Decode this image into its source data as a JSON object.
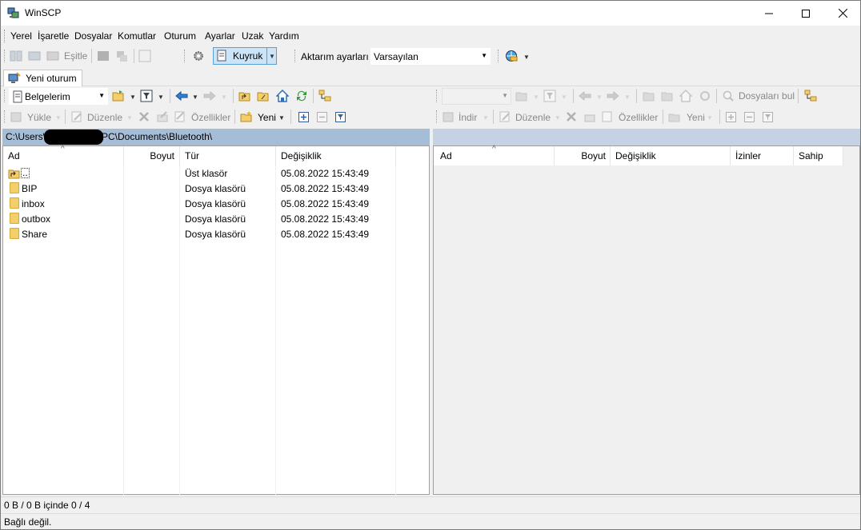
{
  "window": {
    "title": "WinSCP"
  },
  "menu": [
    "Yerel",
    "İşaretle",
    "Dosyalar",
    "Komutlar",
    "Oturum",
    "Ayarlar",
    "Uzak",
    "Yardım"
  ],
  "toolbar": {
    "synchronize_label": "Eşitle",
    "queue_label": "Kuyruk",
    "transfer_settings_label": "Aktarım ayarları",
    "transfer_settings_value": "Varsayılan"
  },
  "session_tab": {
    "label": "Yeni oturum"
  },
  "left_panel": {
    "location": "Belgelerim",
    "path_prefix": "C:\\Users\\",
    "path_suffix": "PC\\Documents\\Bluetooth\\",
    "actions": {
      "upload": "Yükle",
      "edit": "Düzenle",
      "properties": "Özellikler",
      "new": "Yeni"
    },
    "columns": {
      "name": "Ad",
      "size": "Boyut",
      "type": "Tür",
      "changed": "Değişiklik"
    },
    "rows": [
      {
        "name": "..",
        "type": "Üst klasör",
        "changed": "05.08.2022  15:43:49",
        "icon": "parent-folder-icon"
      },
      {
        "name": "BIP",
        "type": "Dosya klasörü",
        "changed": "05.08.2022  15:43:49",
        "icon": "folder-icon"
      },
      {
        "name": "inbox",
        "type": "Dosya klasörü",
        "changed": "05.08.2022  15:43:49",
        "icon": "folder-icon"
      },
      {
        "name": "outbox",
        "type": "Dosya klasörü",
        "changed": "05.08.2022  15:43:49",
        "icon": "folder-icon"
      },
      {
        "name": "Share",
        "type": "Dosya klasörü",
        "changed": "05.08.2022  15:43:49",
        "icon": "folder-icon"
      }
    ]
  },
  "right_panel": {
    "find_files": "Dosyaları bul",
    "actions": {
      "download": "İndir",
      "edit": "Düzenle",
      "properties": "Özellikler",
      "new": "Yeni"
    },
    "columns": {
      "name": "Ad",
      "size": "Boyut",
      "changed": "Değişiklik",
      "rights": "İzinler",
      "owner": "Sahip"
    }
  },
  "status": {
    "selection": "0 B / 0 B içinde 0 / 4",
    "connection": "Bağlı değil."
  },
  "colors": {
    "active_path": "#a6bdd8",
    "inactive_path": "#c4d2e3",
    "queue_highlight": "#cce4f7"
  }
}
